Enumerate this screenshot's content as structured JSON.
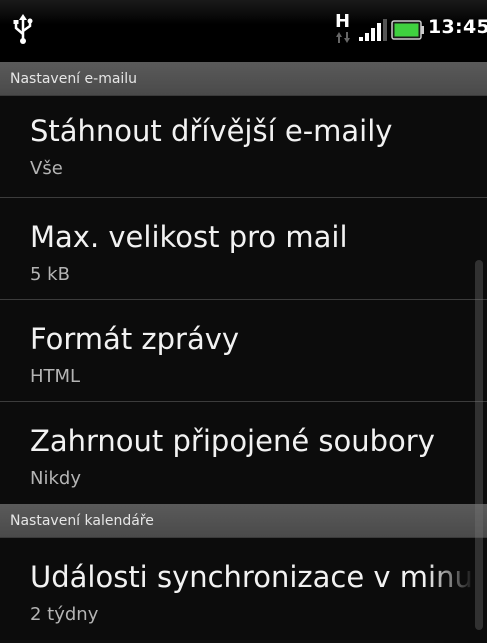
{
  "status_bar": {
    "time": "13:45",
    "network_type": "H",
    "icons": [
      "usb-icon",
      "h-icon",
      "signal-icon",
      "battery-icon"
    ]
  },
  "sections": [
    {
      "header": "Nastavení e-mailu",
      "items": [
        {
          "title": "Stáhnout dřívější e-maily",
          "summary": "Vše"
        },
        {
          "title": "Max. velikost pro mail",
          "summary": "5 kB"
        },
        {
          "title": "Formát zprávy",
          "summary": "HTML"
        },
        {
          "title": "Zahrnout připojené soubory",
          "summary": "Nikdy"
        }
      ]
    },
    {
      "header": "Nastavení kalendáře",
      "items": [
        {
          "title": "Události synchronizace v minu",
          "summary": "2 týdny"
        }
      ]
    }
  ],
  "colors": {
    "background": "#0c0c0c",
    "section_header": "#4f4f4f",
    "title_text": "#f2f2f2",
    "summary_text": "#b4b4b4",
    "battery": "#3fd13f"
  }
}
